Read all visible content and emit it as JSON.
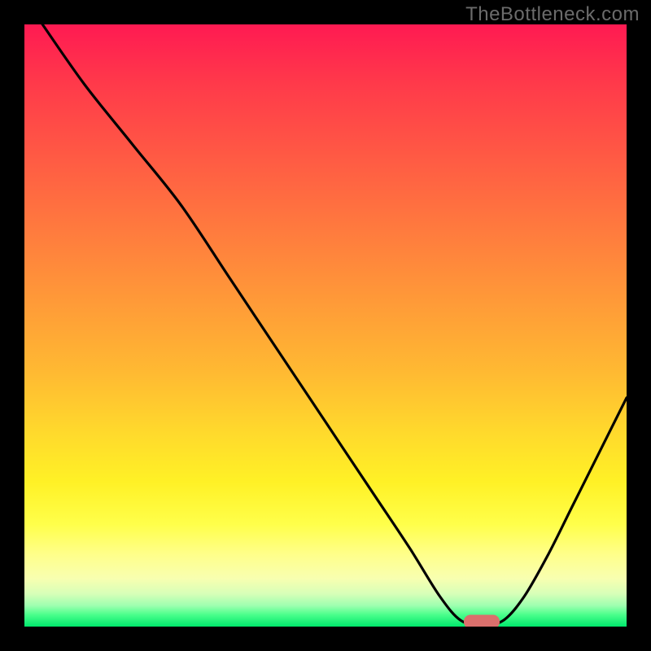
{
  "watermark": "TheBottleneck.com",
  "colors": {
    "frame": "#000000",
    "watermark_text": "#6b6b6b",
    "curve_stroke": "#000000",
    "marker_fill": "#da6f6c",
    "gradient_stops": [
      "#ff1a52",
      "#ff3a4a",
      "#ff5a44",
      "#ff7a3e",
      "#ff9a38",
      "#ffba32",
      "#ffda2c",
      "#fff126",
      "#ffff4a",
      "#ffff8a",
      "#f8ffb0",
      "#d8ffb8",
      "#9fffb0",
      "#4cff8c",
      "#00e86c"
    ]
  },
  "chart_data": {
    "type": "line",
    "title": "",
    "xlabel": "",
    "ylabel": "",
    "xlim": [
      0,
      100
    ],
    "ylim": [
      0,
      100
    ],
    "note": "Axes are unlabeled in the source image; x/y are normalized 0-100. y=0 is the bottom (green) edge, y=100 is the top (red) edge. The curve is a V-shape with its minimum touching y≈0 around x≈73-79, and a small rounded pill marker sits at the trough.",
    "series": [
      {
        "name": "curve",
        "x": [
          3.0,
          10.0,
          18.0,
          26.0,
          34.0,
          42.0,
          50.0,
          58.0,
          64.0,
          69.0,
          72.5,
          76.0,
          79.5,
          83.0,
          87.0,
          91.0,
          95.0,
          100.0
        ],
        "y": [
          100.0,
          90.0,
          80.0,
          70.0,
          58.0,
          46.0,
          34.0,
          22.0,
          13.0,
          5.0,
          1.0,
          0.3,
          1.0,
          5.0,
          12.0,
          20.0,
          28.0,
          38.0
        ]
      }
    ],
    "marker": {
      "x": 76.0,
      "y": 0.8
    }
  }
}
